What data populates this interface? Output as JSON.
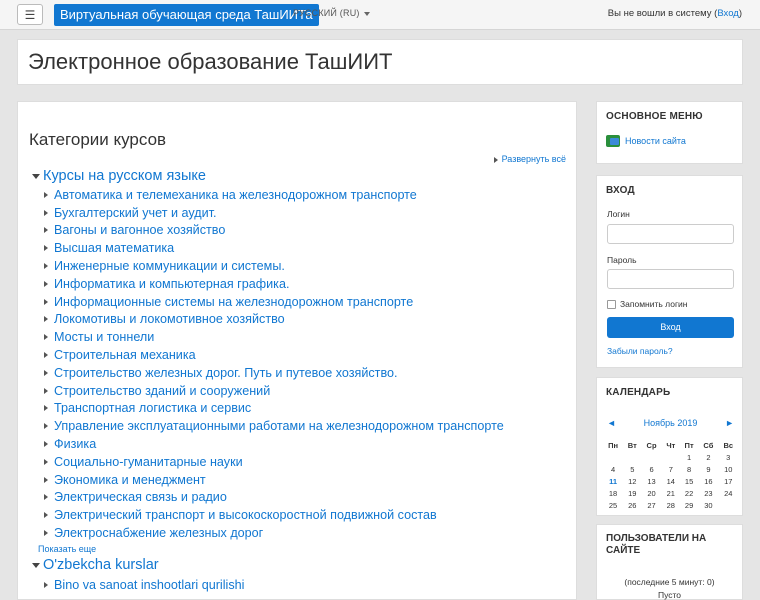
{
  "navbar": {
    "site_name": "Виртуальная обучающая среда ТашИИТа",
    "language": "РУССКИЙ (RU)",
    "login_status_prefix": "Вы не вошли в систему (",
    "login_link": "Вход",
    "login_status_suffix": ")"
  },
  "header": {
    "title": "Электронное образование ТашИИТ"
  },
  "main": {
    "heading": "Категории курсов",
    "expand_all": "Развернуть всё",
    "category1": {
      "name": "Курсы на русском языке",
      "courses": [
        "Автоматика и телемеханика на железнодорожном транспорте",
        "Бухгалтерский учет и аудит.",
        "Вагоны и вагонное хозяйство",
        "Высшая математика",
        "Инженерные коммуникации и системы.",
        "Информатика и компьютерная графика.",
        "Информационные системы на железнодорожном транспорте",
        "Локомотивы и локомотивное хозяйство",
        "Мосты и тоннели",
        "Строительная механика",
        "Строительство железных дорог. Путь и путевое хозяйство.",
        "Строительство зданий и сооружений",
        "Транспортная логистика и сервис",
        "Управление эксплуатационными работами на железнодорожном транспорте",
        "Физика",
        "Социально-гуманитарные науки",
        "Экономика и менеджмент",
        "Электрическая связь и радио",
        "Электрический транспорт и высокоскоростной подвижной состав",
        "Электроснабжение железных дорог"
      ],
      "show_more": "Показать еще"
    },
    "category2": {
      "name": "O'zbekcha kurslar",
      "courses": [
        "Bino va sanoat inshootlari qurilishi"
      ]
    }
  },
  "main_menu": {
    "title": "ОСНОВНОЕ МЕНЮ",
    "news_link": "Новости сайта"
  },
  "login_block": {
    "title": "ВХОД",
    "username_label": "Логин",
    "password_label": "Пароль",
    "remember_label": "Запомнить логин",
    "login_button": "Вход",
    "forgot_link": "Забыли пароль?"
  },
  "calendar": {
    "title": "КАЛЕНДАРЬ",
    "prev": "◄",
    "next": "►",
    "month": "Ноябрь 2019",
    "weekdays": [
      "Пн",
      "Вт",
      "Ср",
      "Чт",
      "Пт",
      "Сб",
      "Вс"
    ],
    "weeks": [
      [
        "",
        "",
        "",
        "",
        "1",
        "2",
        "3"
      ],
      [
        "4",
        "5",
        "6",
        "7",
        "8",
        "9",
        "10"
      ],
      [
        "11",
        "12",
        "13",
        "14",
        "15",
        "16",
        "17"
      ],
      [
        "18",
        "19",
        "20",
        "21",
        "22",
        "23",
        "24"
      ],
      [
        "25",
        "26",
        "27",
        "28",
        "29",
        "30",
        ""
      ]
    ],
    "today": "11"
  },
  "online_users": {
    "title": "ПОЛЬЗОВАТЕЛИ НА САЙТЕ",
    "subtitle": "(последние 5 минут: 0)",
    "empty": "Пусто"
  }
}
